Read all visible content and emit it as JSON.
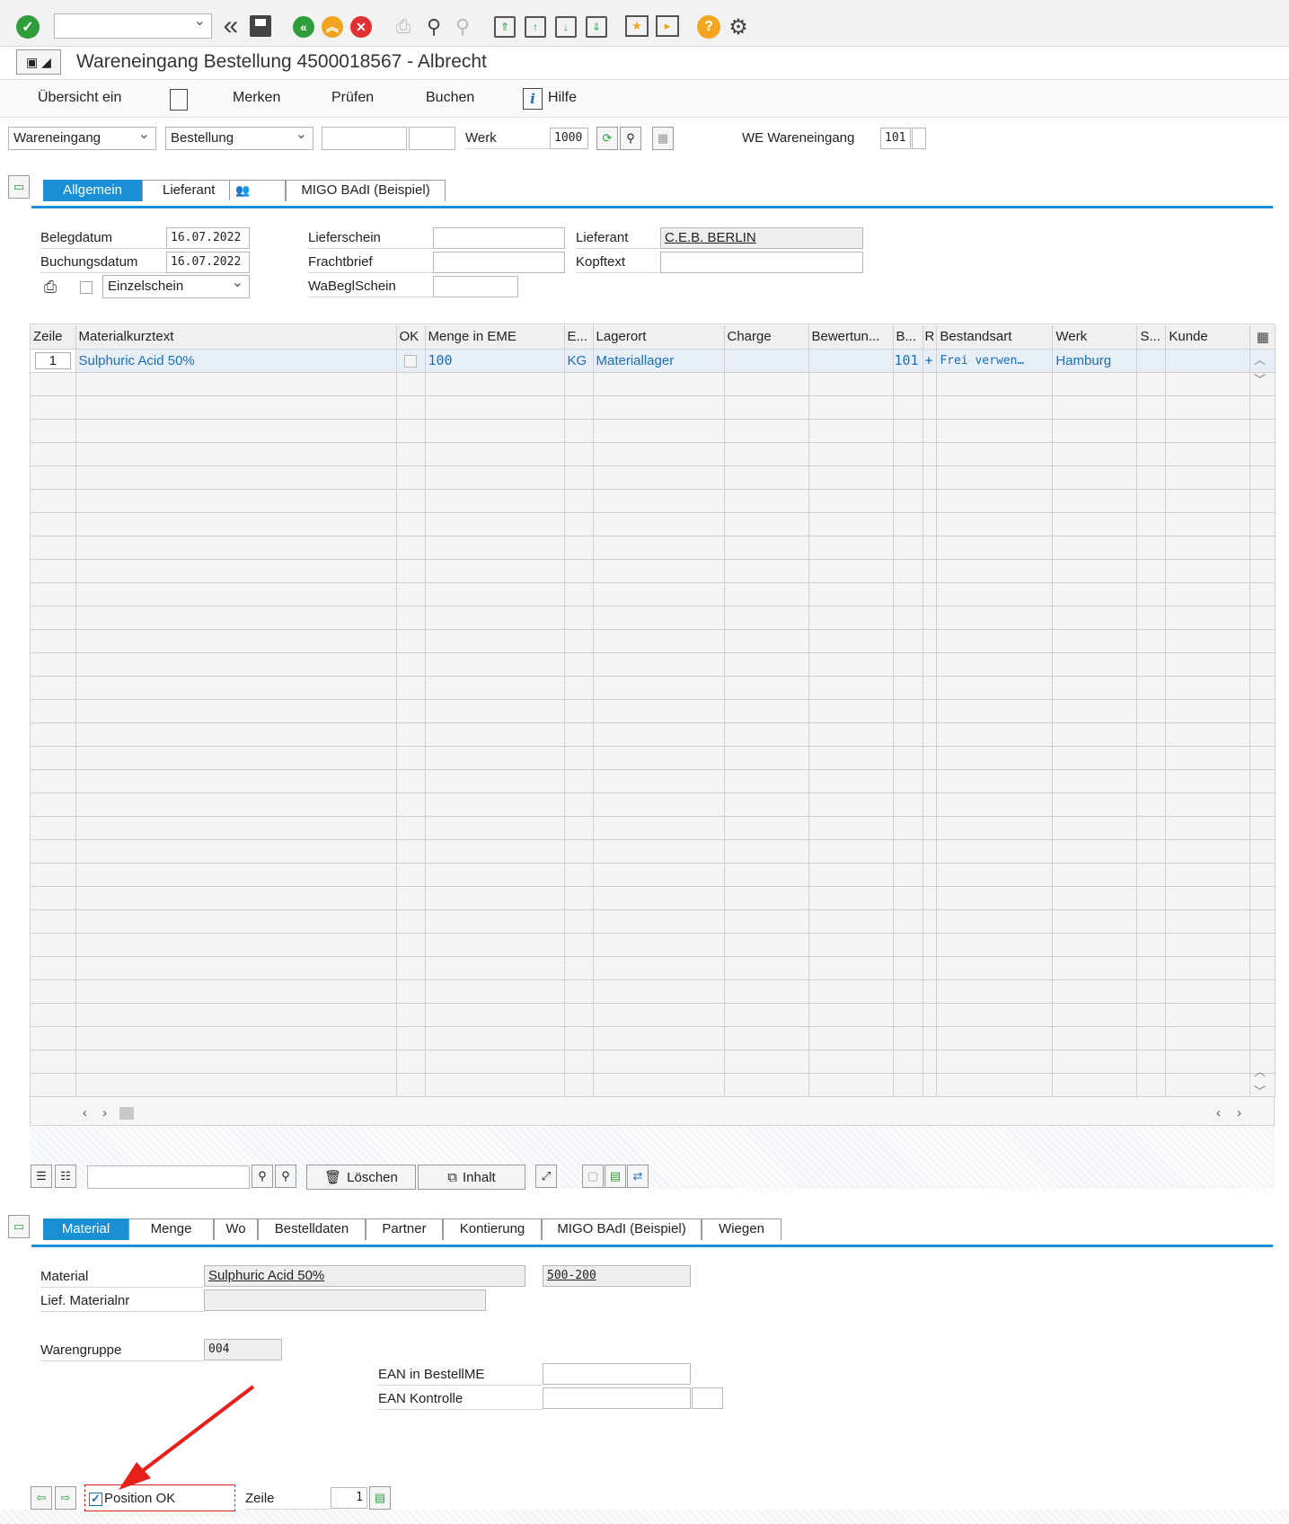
{
  "toolbar": {
    "command_field_value": "",
    "icons": [
      "checkmark-icon",
      "back-double-icon",
      "save-icon",
      "back-icon",
      "exit-icon",
      "cancel-icon",
      "print-icon",
      "find-icon",
      "find-next-icon",
      "first-page-icon",
      "previous-page-icon",
      "next-page-icon",
      "last-page-icon",
      "create-session-icon",
      "shortcut-icon",
      "help-icon",
      "settings-icon"
    ]
  },
  "title": "Wareneingang Bestellung 4500018567 - Albrecht",
  "menu": {
    "overview": "Übersicht ein",
    "remember": "Merken",
    "check": "Prüfen",
    "post": "Buchen",
    "help": "Hilfe"
  },
  "header": {
    "action": "Wareneingang",
    "reference": "Bestellung",
    "ref_number": "",
    "ref_item": "",
    "plant_label": "Werk",
    "plant_value": "1000",
    "movement_label": "WE Wareneingang",
    "movement_type": "101",
    "movement_extra": ""
  },
  "header_tabs": {
    "general": "Allgemein",
    "vendor": "Lieferant",
    "badi": "MIGO BAdI (Beispiel)"
  },
  "general": {
    "doc_date_label": "Belegdatum",
    "doc_date": "16.07.2022",
    "posting_date_label": "Buchungsdatum",
    "posting_date": "16.07.2022",
    "print_option": "Einzelschein",
    "delivery_note_label": "Lieferschein",
    "delivery_note": "",
    "bill_of_lading_label": "Frachtbrief",
    "bill_of_lading": "",
    "gr_slip_label": "WaBeglSchein",
    "gr_slip": "",
    "vendor_label": "Lieferant",
    "vendor": "C.E.B. BERLIN",
    "header_text_label": "Kopftext",
    "header_text": ""
  },
  "items_table": {
    "columns": [
      "Zeile",
      "Materialkurztext",
      "OK",
      "Menge in EME",
      "E...",
      "Lagerort",
      "Charge",
      "Bewertun...",
      "B...",
      "R",
      "Bestandsart",
      "Werk",
      "S...",
      "Kunde"
    ],
    "rows": [
      {
        "line": "1",
        "material": "Sulphuric Acid 50%",
        "ok": "",
        "qty": "100",
        "unit": "KG",
        "storage": "Materiallager",
        "batch": "",
        "valuation": "",
        "mvt": "101",
        "r": "+",
        "stock_type": "Frei verwen…",
        "plant": "Hamburg",
        "s": "",
        "customer": ""
      }
    ]
  },
  "item_toolbar": {
    "search_value": "",
    "delete": "Löschen",
    "content": "Inhalt"
  },
  "detail_tabs": {
    "material": "Material",
    "quantity": "Menge",
    "where": "Wo",
    "po_data": "Bestelldaten",
    "partner": "Partner",
    "account": "Kontierung",
    "badi": "MIGO BAdI (Beispiel)",
    "weigh": "Wiegen"
  },
  "detail": {
    "material_label": "Material",
    "material_text": "Sulphuric Acid 50%",
    "material_number": "500-200",
    "vendor_matnr_label": "Lief. Materialnr",
    "vendor_matnr": "",
    "matgroup_label": "Warengruppe",
    "matgroup": "004",
    "ean_label": "EAN in BestellME",
    "ean": "",
    "ean_check_label": "EAN Kontrolle",
    "ean_check": "",
    "ean_check_extra": ""
  },
  "footer": {
    "position_ok_label": "Position OK",
    "position_ok_checked": true,
    "line_label": "Zeile",
    "line_value": "1"
  },
  "colors": {
    "accent": "#1a8fd6",
    "link": "#1a6fb8",
    "ok_green": "#2e9d3a",
    "warn_orange": "#f2a61f",
    "cancel_red": "#e03030",
    "arrow_red": "#e8201c"
  }
}
